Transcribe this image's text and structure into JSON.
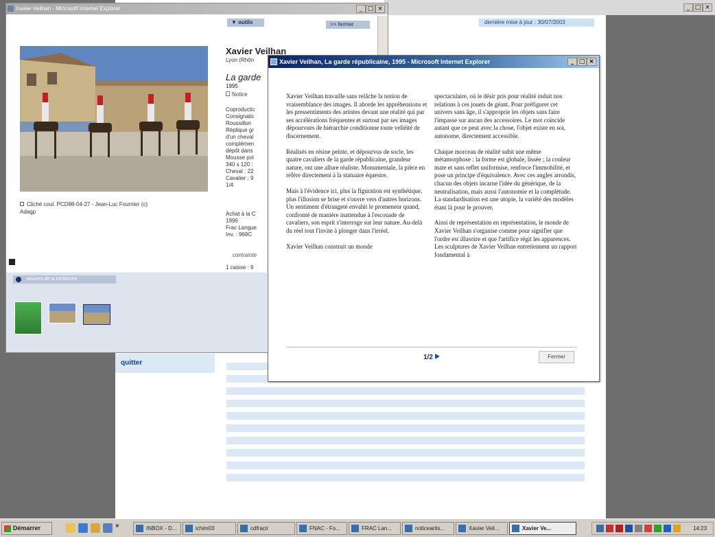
{
  "background_window": {
    "update_text": "dernière mise à jour : 30/07/2003",
    "quit_label": "quitter",
    "controls": [
      "_",
      "□",
      "×"
    ]
  },
  "window1": {
    "title": "Xavier Veilhan - Microsoft Internet Explorer",
    "controls": [
      "_",
      "□",
      "×"
    ],
    "outils_label": "▼ outils",
    "fermer_label": ">> fermer",
    "caption": "Cliché coul. PCD98-04-27 - Jean-Luc Fournier (c) Adagp",
    "artist": "Xavier Veilhan",
    "birth": "Lyon (Rhôn",
    "work_title": "La garde",
    "year": "1995",
    "notice_label": "Notice",
    "details": "Coproductic\nConsignatic\nRoussillon\nRéplique gr\nd'un cheval\ncomplémen\ndépôt dans\nMousse pol\n340 x 120 :\nCheval : 22\nCavalier : 9\n1/4",
    "acquisition": "Achat à la C\n1996\nFrac Langue\nInv. : 968C",
    "contrainte": "contrainte",
    "caisse": "1 caisse : 9",
    "works_header": "œuvres de la recherche"
  },
  "window2": {
    "title": "Xavier Veilhan, La garde républicaine, 1995 - Microsoft Internet Explorer",
    "controls": [
      "_",
      "□",
      "×"
    ],
    "left_column": [
      "Xavier Veilhan travaille sans relâche la notion de vraisemblance des images. Il aborde les appréhensions et les pressentiments des artistes devant une réalité qui par ses accélérations fréquentes et surtout par ses images dépourvues de hiérarchie conditionne toute velléité de discernement.",
      "Réalisés en résine peinte, et dépourvus de socle, les quatre cavaliers de la garde républicaine, grandeur nature, ont une allure réaliste. Monumentale, la pièce en réfère directement à la statuaire équestre.",
      "Mais à l'évidence ici, plus la figuration est synthétique, plus l'illusion se brise et s'ouvre vers d'autres horizons. Un sentiment d'étrangeté envahit le promeneur quand, confronté de manière inattendue à l'escouade de cavaliers, son esprit s'interroge sur leur nature. Au-delà du réel tout l'invite à plonger dans l'irréel.",
      "Xavier Veilhan construit un monde"
    ],
    "right_column": [
      "spectaculaire, où le désir pris pour réalité induit nos relations à ces jouets de géant. Pour préfigurer cet univers sans âge, il s'approprie les objets sans faire l'impasse sur aucun des accessoires. Le mot coïncide autant que ce peut avec la chose, l'objet existe en soi, autonome, directement accessible.",
      "Chaque morceau de réalité subit une même métamorphose : la forme est globale, lissée ; la couleur mate et sans reflet uniformise, renforce l'immobilité, et pose un principe d'équivalence. Avec ces angles arrondis, chacun des objets incarne l'idée du générique, de la neutralisation, mais aussi l'autonomie et la complétude. La standardisation est une utopie, la variété des modèles étant là pour le prouver.",
      "Ainsi de représentation en représentation, le monde de Xavier Veilhan s'organise comme pour signifier que l'ordre est illusoire et que l'artifice régit les apparences. Les sculptures de Xavier Veilhan entretiennent un rapport fondamental à"
    ],
    "page_indicator": "1/2",
    "close_label": "Fermer"
  },
  "taskbar": {
    "start_label": "Démarrer",
    "overflow": "»",
    "tasks": [
      {
        "label": "INBOX - D...",
        "active": false
      },
      {
        "label": "ichim03",
        "active": false
      },
      {
        "label": "cdfracir",
        "active": false
      },
      {
        "label": "FNAC - Fo...",
        "active": false
      },
      {
        "label": "FRAC Lan...",
        "active": false
      },
      {
        "label": "noticeartis...",
        "active": false
      },
      {
        "label": "Xavier Veil...",
        "active": false
      },
      {
        "label": "Xavier Ve...",
        "active": true
      }
    ],
    "clock": "14:23"
  },
  "colors": {
    "desktop": "#6e6e6e",
    "active_title": "#0a246a",
    "accent_blue": "#1c2e60",
    "stripe": "#dce8f4"
  }
}
